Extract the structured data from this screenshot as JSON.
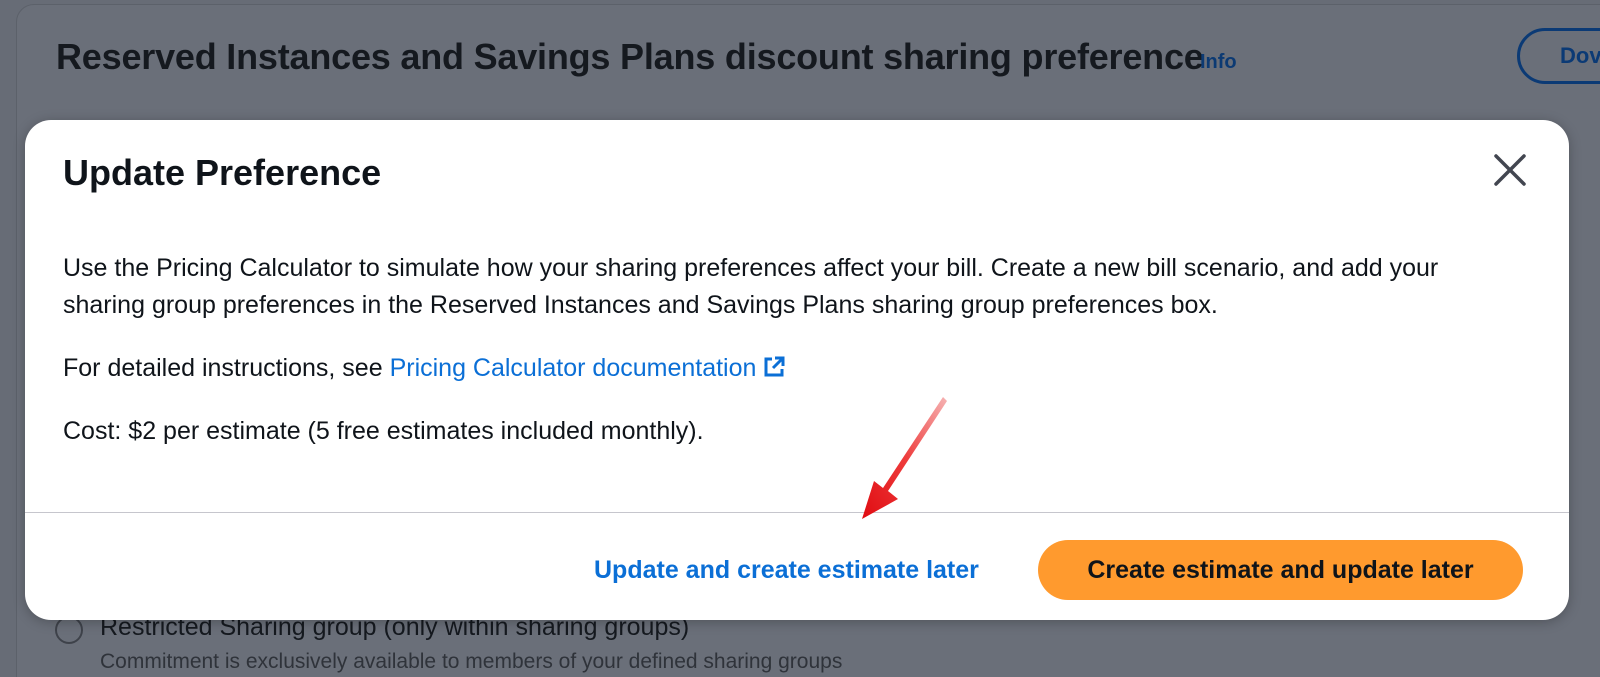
{
  "background": {
    "title": "Reserved Instances and Savings Plans discount sharing preference",
    "info_link": "Info",
    "download_button": "Dov",
    "radio_label": "Restricted Sharing group (only within sharing groups)",
    "radio_description": "Commitment is exclusively available to members of your defined sharing groups"
  },
  "modal": {
    "title": "Update Preference",
    "body_paragraph_1": "Use the Pricing Calculator to simulate how your sharing preferences affect your bill. Create a new bill scenario, and add your sharing group preferences in the Reserved Instances and Savings Plans sharing group preferences box.",
    "instructions_prefix": "For detailed instructions, see ",
    "documentation_link": "Pricing Calculator documentation",
    "cost_text": "Cost: $2 per estimate (5 free estimates included monthly).",
    "secondary_button": "Update and create estimate later",
    "primary_button": "Create estimate and update later"
  },
  "colors": {
    "overlay": "#676c76",
    "link": "#0b6fd6",
    "primary_button": "#ff9a2e",
    "annotation_arrow": "#e8141a"
  },
  "icons": {
    "close": "close-icon",
    "external_link": "external-link-icon",
    "annotation": "red-arrow-annotation-icon"
  }
}
